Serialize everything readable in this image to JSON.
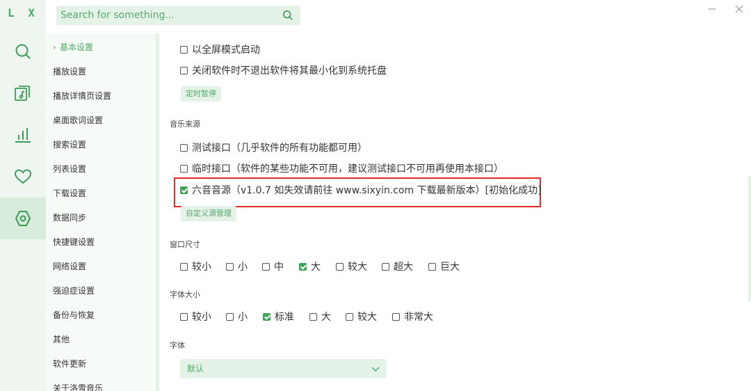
{
  "app": {
    "logo": "L X"
  },
  "sidebar_icons": [
    "search-icon",
    "music-library-icon",
    "leaderboard-icon",
    "heart-icon",
    "settings-icon"
  ],
  "search": {
    "placeholder": "Search for something..."
  },
  "window_controls": [
    "minimize-icon",
    "close-icon"
  ],
  "menu": {
    "items": [
      {
        "label": "基本设置",
        "active": true
      },
      {
        "label": "播放设置"
      },
      {
        "label": "播放详情页设置"
      },
      {
        "label": "桌面歌词设置"
      },
      {
        "label": "搜索设置"
      },
      {
        "label": "列表设置"
      },
      {
        "label": "下载设置"
      },
      {
        "label": "数据同步"
      },
      {
        "label": "快捷键设置"
      },
      {
        "label": "网络设置"
      },
      {
        "label": "强迫症设置"
      },
      {
        "label": "备份与恢复"
      },
      {
        "label": "其他"
      },
      {
        "label": "软件更新"
      },
      {
        "label": "关于洛雪音乐"
      }
    ]
  },
  "basic": {
    "fullscreen_label": "以全屏模式启动",
    "tray_label": "关闭软件时不退出软件将其最小化到系统托盘",
    "timer_button": "定时暂停"
  },
  "music_source": {
    "title": "音乐来源",
    "options": [
      {
        "label": "测试接口（几乎软件的所有功能都可用）",
        "checked": false
      },
      {
        "label": "临时接口（软件的某些功能不可用，建议测试接口不可用再使用本接口）",
        "checked": false
      },
      {
        "label": "六音音源（v1.0.7 如失效请前往 www.sixyin.com 下载最新版本）[初始化成功]",
        "checked": true
      }
    ],
    "custom_button": "自定义源管理"
  },
  "window_size": {
    "title": "窗口尺寸",
    "options": [
      {
        "label": "较小",
        "checked": false
      },
      {
        "label": "小",
        "checked": false
      },
      {
        "label": "中",
        "checked": false
      },
      {
        "label": "大",
        "checked": true
      },
      {
        "label": "较大",
        "checked": false
      },
      {
        "label": "超大",
        "checked": false
      },
      {
        "label": "巨大",
        "checked": false
      }
    ]
  },
  "font_size": {
    "title": "字体大小",
    "options": [
      {
        "label": "较小",
        "checked": false
      },
      {
        "label": "小",
        "checked": false
      },
      {
        "label": "标准",
        "checked": true
      },
      {
        "label": "大",
        "checked": false
      },
      {
        "label": "较大",
        "checked": false
      },
      {
        "label": "非常大",
        "checked": false
      }
    ]
  },
  "font": {
    "title": "字体",
    "selected": "默认"
  },
  "colors": {
    "accent": "#4dab67",
    "highlight_border": "#e32626"
  }
}
